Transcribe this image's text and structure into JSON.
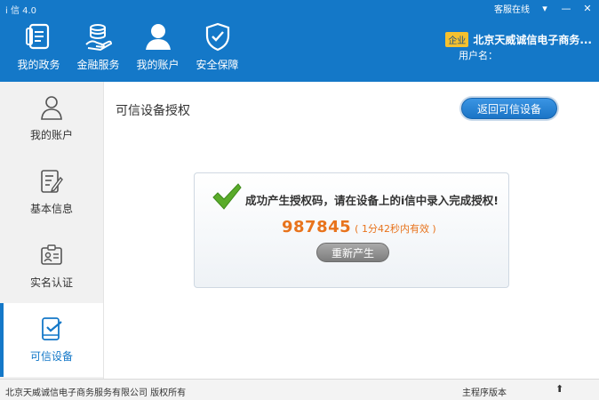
{
  "window": {
    "title": "i 信 4.0",
    "online_service": "客服在线",
    "menu_glyph": "▾",
    "minimize_glyph": "—",
    "close_glyph": "✕"
  },
  "nav": {
    "items": [
      {
        "label": "我的政务",
        "icon": "document-icon"
      },
      {
        "label": "金融服务",
        "icon": "coins-icon"
      },
      {
        "label": "我的账户",
        "icon": "user-icon"
      },
      {
        "label": "安全保障",
        "icon": "shield-icon"
      }
    ]
  },
  "company": {
    "badge": "企业",
    "name": "北京天威诚信电子商务...",
    "user_label": "用户名："
  },
  "sidebar": {
    "items": [
      {
        "label": "我的账户",
        "icon": "user-icon"
      },
      {
        "label": "基本信息",
        "icon": "edit-document-icon"
      },
      {
        "label": "实名认证",
        "icon": "id-card-icon"
      },
      {
        "label": "可信设备",
        "icon": "device-check-icon",
        "active": true
      }
    ]
  },
  "main": {
    "title": "可信设备授权",
    "back_button": "返回可信设备",
    "success_message": "成功产生授权码，请在设备上的i信中录入完成授权!",
    "auth_code": "987845",
    "expiry": "( 1分42秒内有效 )",
    "regenerate_button": "重新产生"
  },
  "footer": {
    "copyright": "北京天威诚信电子商务服务有限公司 版权所有",
    "version": "主程序版本",
    "up_glyph": "⬆"
  },
  "colors": {
    "brand_blue": "#1478c8",
    "accent_orange": "#e8731c",
    "success_green": "#5aab2a"
  }
}
